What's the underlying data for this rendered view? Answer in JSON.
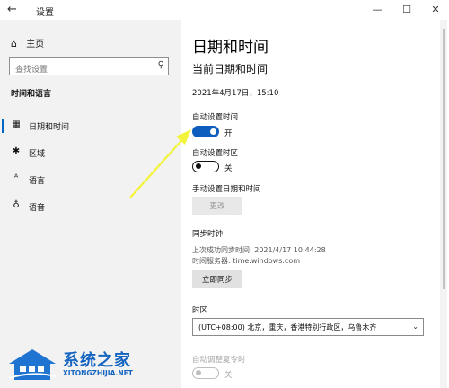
{
  "window": {
    "title": "设置",
    "back_icon": "back-arrow-icon",
    "controls": {
      "minimize": "—",
      "maximize": "☐",
      "close": "✕"
    }
  },
  "sidebar": {
    "home_label": "主页",
    "search_placeholder": "查找设置",
    "section_title": "时间和语言",
    "items": [
      {
        "label": "日期和时间",
        "icon": "calendar-clock-icon",
        "active": true
      },
      {
        "label": "区域",
        "icon": "globe-gear-icon",
        "active": false
      },
      {
        "label": "语言",
        "icon": "language-icon",
        "active": false
      },
      {
        "label": "语音",
        "icon": "microphone-icon",
        "active": false
      }
    ]
  },
  "main": {
    "title": "日期和时间",
    "current_heading": "当前日期和时间",
    "current_datetime": "2021年4月17日，15:10",
    "auto_time": {
      "label": "自动设置时间",
      "state": "开",
      "on": true
    },
    "auto_timezone": {
      "label": "自动设置时区",
      "state": "关",
      "on": false
    },
    "manual": {
      "label": "手动设置日期和时间",
      "button": "更改"
    },
    "sync": {
      "heading": "同步时钟",
      "last_sync": "上次成功同步时间: 2021/4/17 10:44:28",
      "server": "时间服务器: time.windows.com",
      "button": "立即同步"
    },
    "timezone": {
      "label": "时区",
      "value": "(UTC+08:00) 北京，重庆，香港特别行政区，乌鲁木齐"
    },
    "dst": {
      "label": "自动调整夏令时",
      "state": "关",
      "on": false
    }
  },
  "watermark": {
    "cn": "系统之家",
    "en": "XITONGZHIJIA.NET"
  },
  "colors": {
    "accent": "#0d5dbe",
    "sidebar_bg": "#f2f2f2",
    "annotation_arrow": "#f3f33a"
  }
}
